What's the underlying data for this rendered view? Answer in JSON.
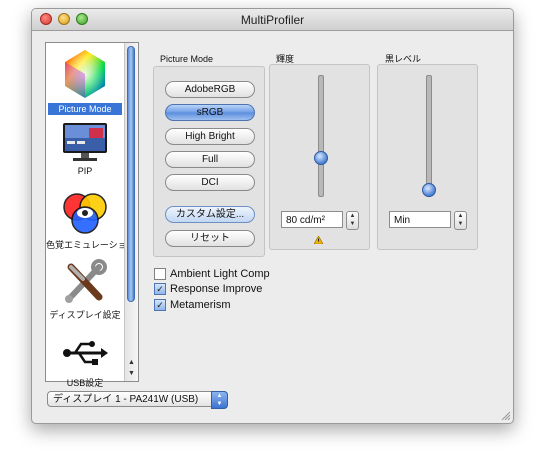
{
  "window": {
    "title": "MultiProfiler"
  },
  "sidebar": {
    "items": [
      {
        "label": "Picture Mode",
        "icon": "color-cube-icon",
        "selected": true
      },
      {
        "label": "PIP",
        "icon": "monitor-icon",
        "selected": false
      },
      {
        "label": "色覚エミュレーション",
        "icon": "color-emulation-icon",
        "selected": false
      },
      {
        "label": "ディスプレイ設定",
        "icon": "tools-icon",
        "selected": false
      },
      {
        "label": "USB設定",
        "icon": "usb-icon",
        "selected": false
      }
    ]
  },
  "picture_mode": {
    "title": "Picture Mode",
    "modes": [
      "AdobeRGB",
      "sRGB",
      "High Bright",
      "Full",
      "DCI"
    ],
    "selected": "sRGB",
    "custom_label": "カスタム設定...",
    "reset_label": "リセット"
  },
  "brightness": {
    "title": "輝度",
    "value_text": "80 cd/m²",
    "level": 0.3,
    "warning_icon": "warning-icon"
  },
  "black_level": {
    "title": "黒レベル",
    "value_text": "Min",
    "level": 0.0
  },
  "options": {
    "ambient_light_label": "Ambient Light Comp",
    "ambient_light_checked": false,
    "response_improve_label": "Response Improve",
    "response_improve_checked": true,
    "metamerism_label": "Metamerism",
    "metamerism_checked": true
  },
  "display_select": {
    "value": "ディスプレイ 1 - PA241W (USB)"
  },
  "colors": {
    "accent": "#3875d7",
    "selection": "#3875d7"
  }
}
